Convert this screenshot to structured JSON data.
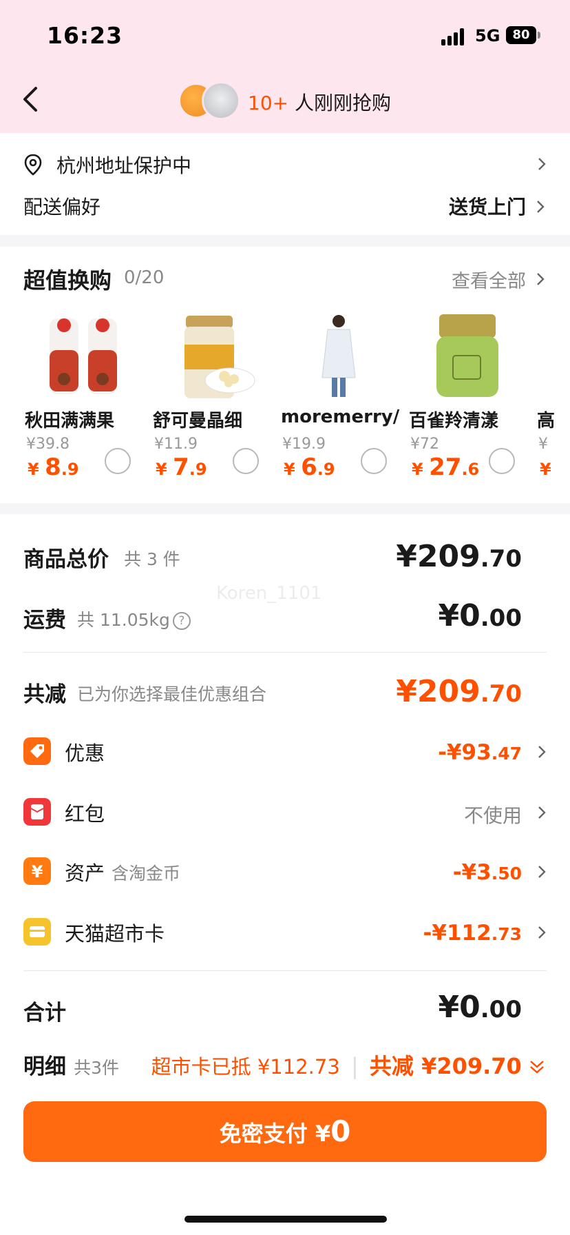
{
  "status": {
    "time": "16:23",
    "network": "5G",
    "battery": "80"
  },
  "header": {
    "buyers_count": "10+",
    "buyers_text": "人刚刚抢购"
  },
  "address": {
    "text": "杭州地址保护中",
    "delivery_label": "配送偏好",
    "delivery_value": "送货上门"
  },
  "addon": {
    "title": "超值换购",
    "count": "0/20",
    "see_all": "查看全部",
    "products": [
      {
        "name": "秋田满满果",
        "orig": "¥39.8",
        "price_int": "8",
        "price_dec": ".9"
      },
      {
        "name": "舒可曼晶细",
        "orig": "¥11.9",
        "price_int": "7",
        "price_dec": ".9"
      },
      {
        "name": "moremerry/",
        "orig": "¥19.9",
        "price_int": "6",
        "price_dec": ".9"
      },
      {
        "name": "百雀羚清漾",
        "orig": "¥72",
        "price_int": "27",
        "price_dec": ".6"
      },
      {
        "name": "高",
        "orig": "¥",
        "price_int": "",
        "price_dec": ""
      }
    ]
  },
  "summary": {
    "total_label": "商品总价",
    "total_count": "共 3 件",
    "total_int": "¥209",
    "total_dec": ".70",
    "shipping_label": "运费",
    "shipping_weight": "共 11.05kg",
    "shipping_int": "¥0",
    "shipping_dec": ".00",
    "reduce_label": "共减",
    "reduce_desc": "已为你选择最佳优惠组合",
    "reduce_int": "¥209",
    "reduce_dec": ".70",
    "discounts": [
      {
        "label": "优惠",
        "sub": "",
        "int": "-¥93",
        "dec": ".47"
      },
      {
        "label": "红包",
        "sub": "",
        "value": "不使用"
      },
      {
        "label": "资产",
        "sub": "含淘金币",
        "int": "-¥3",
        "dec": ".50"
      },
      {
        "label": "天猫超市卡",
        "sub": "",
        "int": "-¥112",
        "dec": ".73"
      }
    ],
    "sum_label": "合计",
    "sum_int": "¥0",
    "sum_dec": ".00",
    "detail_label": "明细",
    "detail_count": "共3件",
    "detail_card": "超市卡已抵 ¥112.73",
    "detail_reduce": "共减 ¥209.70"
  },
  "pay": {
    "label": "免密支付 ¥",
    "amount": "0"
  },
  "watermark": "Koren_1101",
  "colors": {
    "accent": "#ff5000",
    "header_bg": "#fde6ee",
    "button": "#ff6a10"
  }
}
